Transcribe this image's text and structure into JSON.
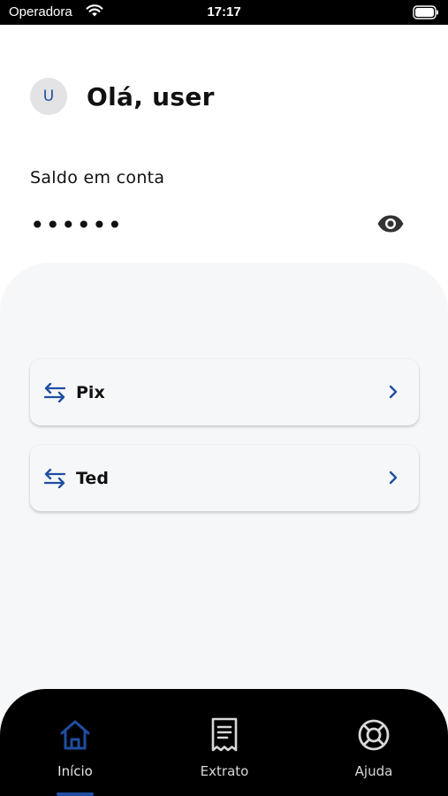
{
  "status_bar": {
    "carrier": "Operadora",
    "time": "17:17",
    "wifi_icon": "wifi-icon",
    "battery_icon": "battery-icon"
  },
  "header": {
    "avatar_initial": "U",
    "greeting": "Olá, user"
  },
  "balance": {
    "label": "Saldo em conta",
    "masked_value": "••••••",
    "toggle_icon": "eye-icon"
  },
  "menu": {
    "items": [
      {
        "label": "Pix",
        "icon": "transfer-arrows-icon",
        "chevron": "chevron-right-icon"
      },
      {
        "label": "Ted",
        "icon": "transfer-arrows-icon",
        "chevron": "chevron-right-icon"
      }
    ]
  },
  "bottom_nav": {
    "items": [
      {
        "label": "Início",
        "icon": "home-icon",
        "active": true
      },
      {
        "label": "Extrato",
        "icon": "receipt-icon",
        "active": false
      },
      {
        "label": "Ajuda",
        "icon": "lifebuoy-icon",
        "active": false
      }
    ]
  },
  "colors": {
    "accent": "#1f4ea1",
    "panel_background": "#f6f7f9",
    "nav_background": "#000000",
    "avatar_background": "#e3e3e6"
  }
}
